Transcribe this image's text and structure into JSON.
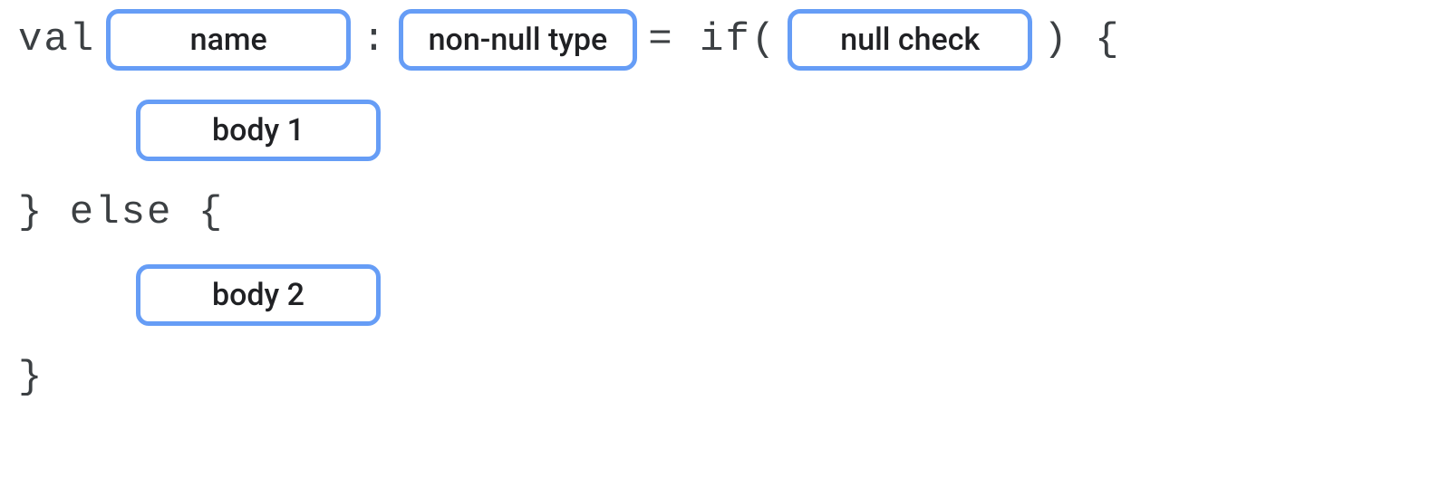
{
  "code": {
    "keyword_val": "val",
    "colon": ":",
    "equals_if_open": "= if(",
    "paren_close_brace_open": ") {",
    "close_brace_else_open": "} else {",
    "close_brace": "}"
  },
  "tokens": {
    "name": "name",
    "type": "non-null type",
    "condition": "null check",
    "body1": "body 1",
    "body2": "body 2"
  }
}
